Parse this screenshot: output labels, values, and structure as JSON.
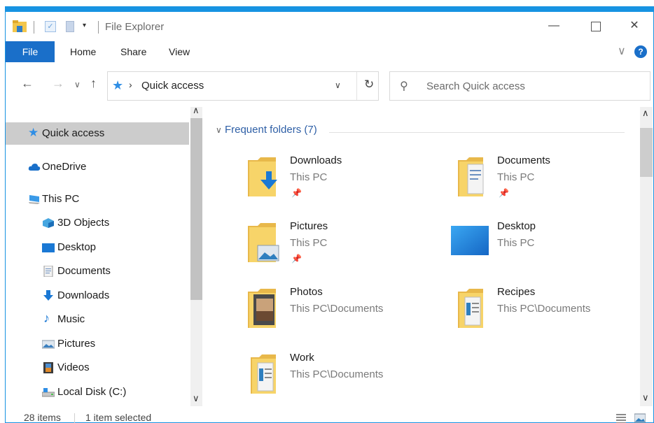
{
  "window": {
    "title": "File Explorer",
    "accent": "#1793e2"
  },
  "ribbon": {
    "tabs": [
      "File",
      "Home",
      "Share",
      "View"
    ],
    "help": "?"
  },
  "address": {
    "location": "Quick access",
    "search_placeholder": "Search Quick access"
  },
  "navpane": {
    "items": [
      {
        "label": "Quick access",
        "icon": "star-icon",
        "selected": true
      },
      {
        "label": "OneDrive",
        "icon": "cloud-icon"
      },
      {
        "label": "This PC",
        "icon": "computer-icon"
      },
      {
        "label": "3D Objects",
        "icon": "cube-icon"
      },
      {
        "label": "Desktop",
        "icon": "desktop-icon"
      },
      {
        "label": "Documents",
        "icon": "document-icon"
      },
      {
        "label": "Downloads",
        "icon": "download-arrow-icon"
      },
      {
        "label": "Music",
        "icon": "music-note-icon"
      },
      {
        "label": "Pictures",
        "icon": "pictures-icon"
      },
      {
        "label": "Videos",
        "icon": "film-icon"
      },
      {
        "label": "Local Disk (C:)",
        "icon": "drive-icon"
      }
    ]
  },
  "content": {
    "group_header": "Frequent folders (7)",
    "folders": [
      {
        "name": "Downloads",
        "location": "This PC",
        "pinned": true,
        "icon": "downloads-folder-icon"
      },
      {
        "name": "Documents",
        "location": "This PC",
        "pinned": true,
        "icon": "documents-folder-icon"
      },
      {
        "name": "Pictures",
        "location": "This PC",
        "pinned": true,
        "icon": "pictures-folder-icon"
      },
      {
        "name": "Desktop",
        "location": "This PC",
        "pinned": false,
        "icon": "desktop-folder-icon"
      },
      {
        "name": "Photos",
        "location": "This PC\\Documents",
        "pinned": false,
        "icon": "photos-folder-icon"
      },
      {
        "name": "Recipes",
        "location": "This PC\\Documents",
        "pinned": false,
        "icon": "recipes-folder-icon"
      },
      {
        "name": "Work",
        "location": "This PC\\Documents",
        "pinned": false,
        "icon": "work-folder-icon"
      }
    ]
  },
  "status": {
    "item_count": "28 items",
    "selection": "1 item selected"
  }
}
